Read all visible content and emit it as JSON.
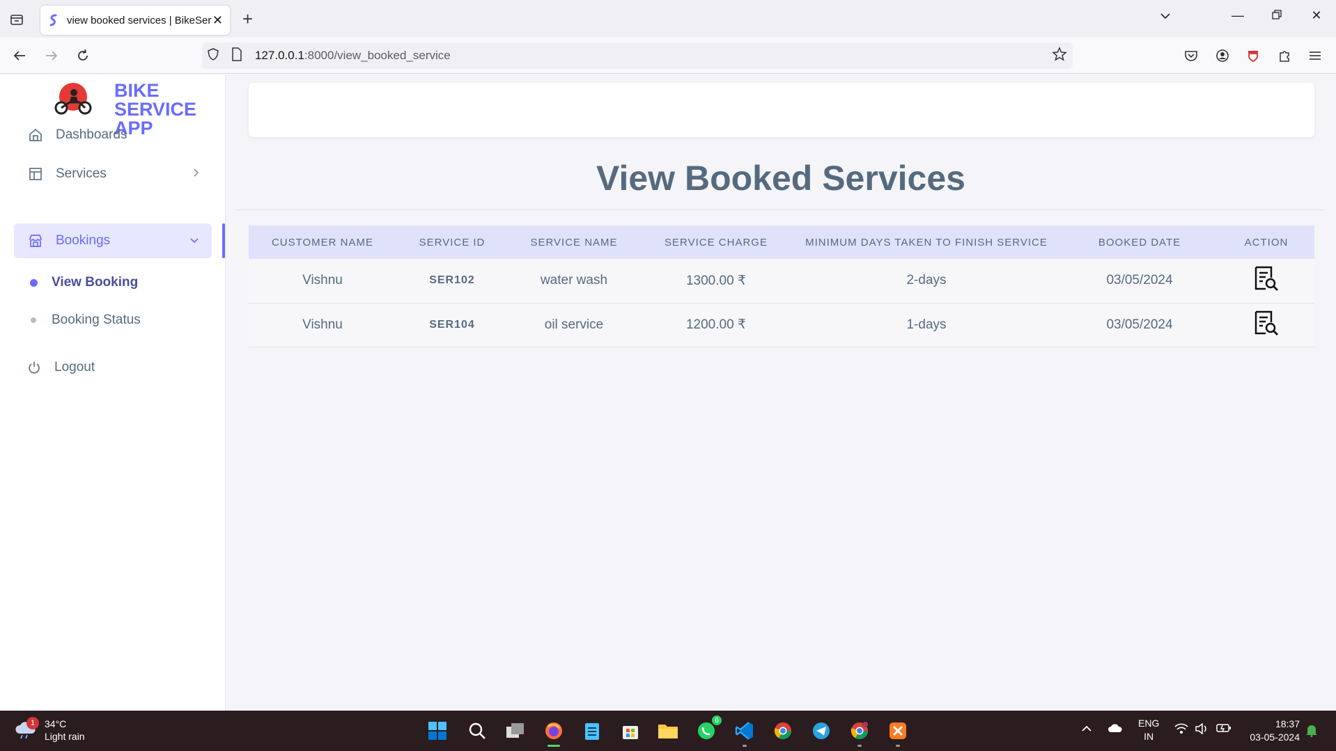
{
  "browser": {
    "tab_title": "view booked services | BikeServ",
    "url_host": "127.0.0.1",
    "url_path": ":8000/view_booked_service"
  },
  "brand": {
    "name": "BIKE SERVICE APP",
    "color": "#696cff"
  },
  "sidebar": {
    "items": [
      {
        "label": "Dashboards",
        "icon": "home-icon"
      },
      {
        "label": "Services",
        "icon": "layout-icon"
      },
      {
        "label": "Bookings",
        "icon": "store-icon"
      }
    ],
    "sub_items": [
      {
        "label": "View Booking",
        "active": true
      },
      {
        "label": "Booking Status",
        "active": false
      }
    ],
    "logout_label": "Logout"
  },
  "page": {
    "title": "View Booked Services"
  },
  "table": {
    "headers": [
      "CUSTOMER NAME",
      "SERVICE ID",
      "SERVICE NAME",
      "SERVICE CHARGE",
      "MINIMUM DAYS TAKEN TO FINISH SERVICE",
      "BOOKED DATE",
      "ACTION"
    ],
    "rows": [
      {
        "customer": "Vishnu",
        "service_id": "SER102",
        "service_name": "water wash",
        "charge": "1300.00 ₹",
        "days": "2-days",
        "date": "03/05/2024"
      },
      {
        "customer": "Vishnu",
        "service_id": "SER104",
        "service_name": "oil service",
        "charge": "1200.00 ₹",
        "days": "1-days",
        "date": "03/05/2024"
      }
    ]
  },
  "taskbar": {
    "weather_temp": "34°C",
    "weather_desc": "Light rain",
    "weather_badge": "1",
    "whatsapp_badge": "6",
    "lang_line1": "ENG",
    "lang_line2": "IN",
    "time": "18:37",
    "date": "03-05-2024"
  }
}
